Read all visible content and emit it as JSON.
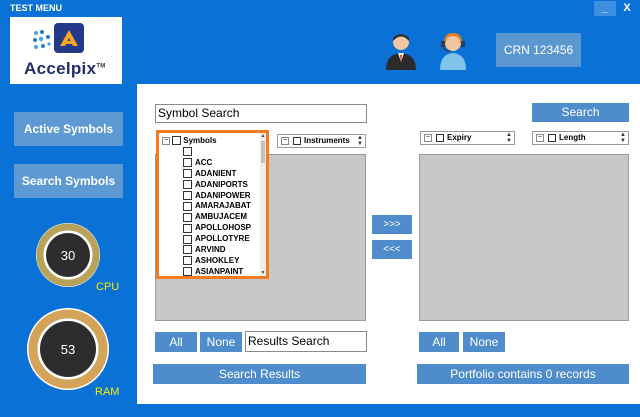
{
  "window": {
    "title": "TEST MENU",
    "minimize_glyph": "_",
    "close_glyph": "X"
  },
  "header": {
    "logo_name": "Accelpix",
    "logo_tm": "TM",
    "crn": "CRN 123456"
  },
  "sidebar": {
    "active_symbols": "Active Symbols",
    "search_symbols": "Search Symbols",
    "cpu": {
      "value": "30",
      "label": "CPU",
      "fraction": 0.3
    },
    "ram": {
      "value": "53",
      "label": "RAM",
      "fraction": 0.53
    }
  },
  "left": {
    "search_value": "Symbol Search",
    "tree_root": "Symbols",
    "symbols": [
      "",
      "ACC",
      "ADANIENT",
      "ADANIPORTS",
      "ADANIPOWER",
      "AMARAJABAT",
      "AMBUJACEM",
      "APOLLOHOSP",
      "APOLLOTYRE",
      "ARVIND",
      "ASHOKLEY",
      "ASIANPAINT"
    ],
    "instruments_header": "Instruments",
    "all": "All",
    "none": "None",
    "results_search": "Results Search",
    "search_results": "Search Results"
  },
  "middle": {
    "move_right": ">>>",
    "move_left": "<<<"
  },
  "right": {
    "search": "Search",
    "expiry_header": "Expiry",
    "length_header": "Length",
    "all": "All",
    "none": "None",
    "portfolio_status": "Portfolio contains 0 records"
  },
  "colors": {
    "brand_blue": "#0a72d6",
    "button_blue": "#4f8ccb",
    "highlight_orange": "#f47b20",
    "gauge_yellow": "#ffe900"
  }
}
